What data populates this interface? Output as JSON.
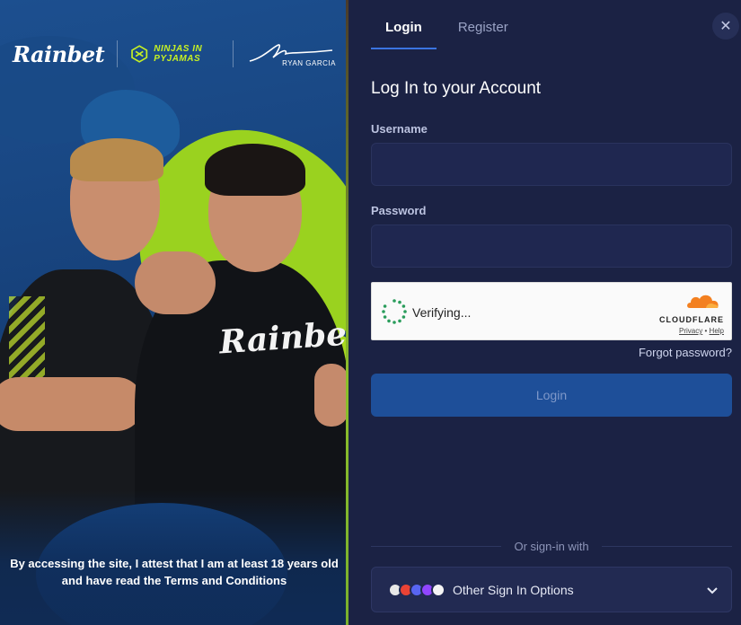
{
  "promo": {
    "brand": "Rainbet",
    "partner1": "NINJAS IN PYJAMAS",
    "partner2": "RYAN GARCIA",
    "shirt_logo": "Rainbet",
    "disclaimer": "By accessing the site, I attest that I am at least 18 years old and have read the Terms and Conditions"
  },
  "tabs": [
    {
      "label": "Login",
      "active": true
    },
    {
      "label": "Register",
      "active": false
    }
  ],
  "close_label": "✕",
  "form": {
    "title": "Log In to your Account",
    "username_label": "Username",
    "username_value": "",
    "password_label": "Password",
    "password_value": "",
    "captcha": {
      "status": "Verifying...",
      "brand": "CLOUDFLARE",
      "privacy": "Privacy",
      "separator": "•",
      "help": "Help"
    },
    "forgot_password": "Forgot password?",
    "login_button": "Login",
    "or_text": "Or sign-in with",
    "other_options": "Other Sign In Options"
  },
  "colors": {
    "background": "#1b2244",
    "accent": "#3b74e0",
    "login_button": "#1e4f99",
    "brand_green": "#c6f024"
  }
}
